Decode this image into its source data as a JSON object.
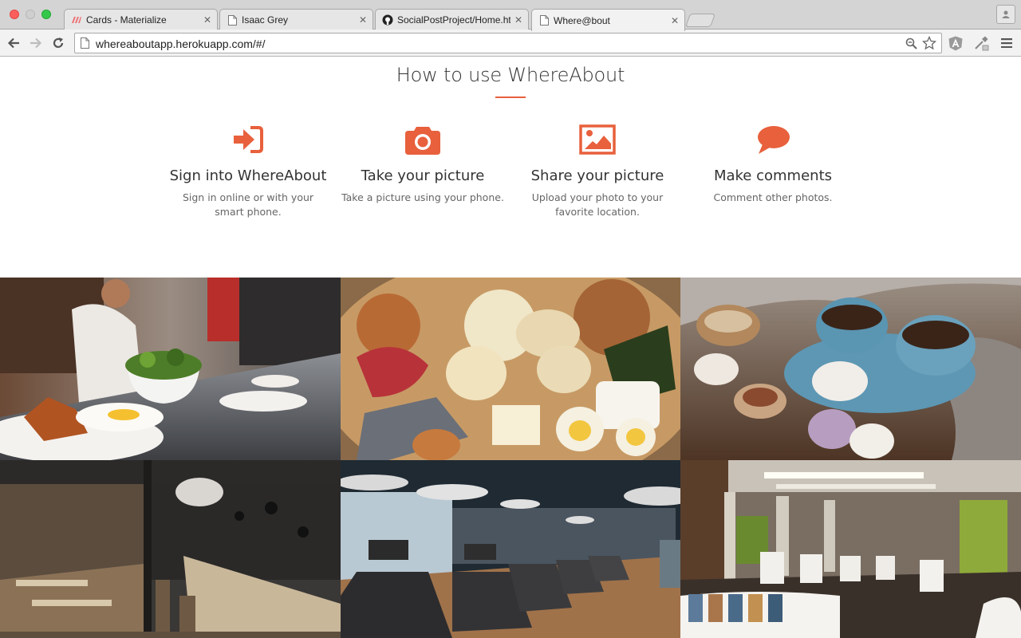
{
  "browser": {
    "tabs": [
      {
        "title": "Cards - Materialize",
        "favicon": "materialize-logo-icon"
      },
      {
        "title": "Isaac Grey",
        "favicon": "page-icon"
      },
      {
        "title": "SocialPostProject/Home.ht",
        "favicon": "github-icon"
      },
      {
        "title": "Where@bout",
        "favicon": "page-icon",
        "active": true
      }
    ],
    "url": "whereaboutapp.herokuapp.com/#/"
  },
  "how_to": {
    "title": "How to use WhereAbout",
    "accent": "#e8603c",
    "steps": [
      {
        "icon": "sign-in-icon",
        "heading": "Sign into WhereAbout",
        "desc": "Sign in online or with your smart phone."
      },
      {
        "icon": "camera-icon",
        "heading": "Take your picture",
        "desc": "Take a picture using your phone."
      },
      {
        "icon": "picture-icon",
        "heading": "Share your picture",
        "desc": "Upload your photo to your favorite location."
      },
      {
        "icon": "comment-icon",
        "heading": "Make comments",
        "desc": "Comment other photos."
      }
    ]
  },
  "gallery": {
    "photos": [
      {
        "subject": "restaurant-kitchen-dishes"
      },
      {
        "subject": "oden-hot-pot"
      },
      {
        "subject": "coffee-and-macarons"
      },
      {
        "subject": "dark-restaurant-interior"
      },
      {
        "subject": "gym-treadmills"
      },
      {
        "subject": "hair-salon-interior"
      }
    ]
  }
}
